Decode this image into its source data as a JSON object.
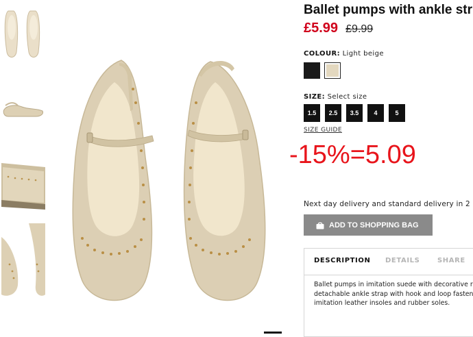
{
  "product": {
    "title": "Ballet pumps with ankle str",
    "price_sale": "£5.99",
    "price_old": "£9.99"
  },
  "colour": {
    "label": "COLOUR:",
    "value": "Light beige",
    "swatches": [
      {
        "name": "Black",
        "hex": "#1a1a1a"
      },
      {
        "name": "Light beige",
        "hex": "#e3d8bf",
        "selected": true
      }
    ]
  },
  "size": {
    "label": "SIZE:",
    "value": "Select size",
    "options": [
      "1.5",
      "2.5",
      "3.5",
      "4",
      "5"
    ],
    "guide_link": "SIZE GUIDE"
  },
  "annotation": {
    "text": "-15%=5.09",
    "color": "#e8141b"
  },
  "delivery": {
    "text": "Next day delivery and standard delivery in 2"
  },
  "add_to_bag": {
    "label": "ADD TO SHOPPING BAG",
    "icon": "shopping-bag-icon"
  },
  "tabs": {
    "items": [
      "DESCRIPTION",
      "DETAILS",
      "SHARE"
    ],
    "active": "DESCRIPTION"
  },
  "description": {
    "lines": [
      "Ballet pumps in imitation suede with decorative r",
      "detachable ankle strap with hook and loop fasten",
      "imitation leather insoles and rubber soles."
    ]
  },
  "colors": {
    "sale_red": "#d0021b",
    "button_grey": "#8a8a8a",
    "shoe_beige": "#dccfb4"
  }
}
